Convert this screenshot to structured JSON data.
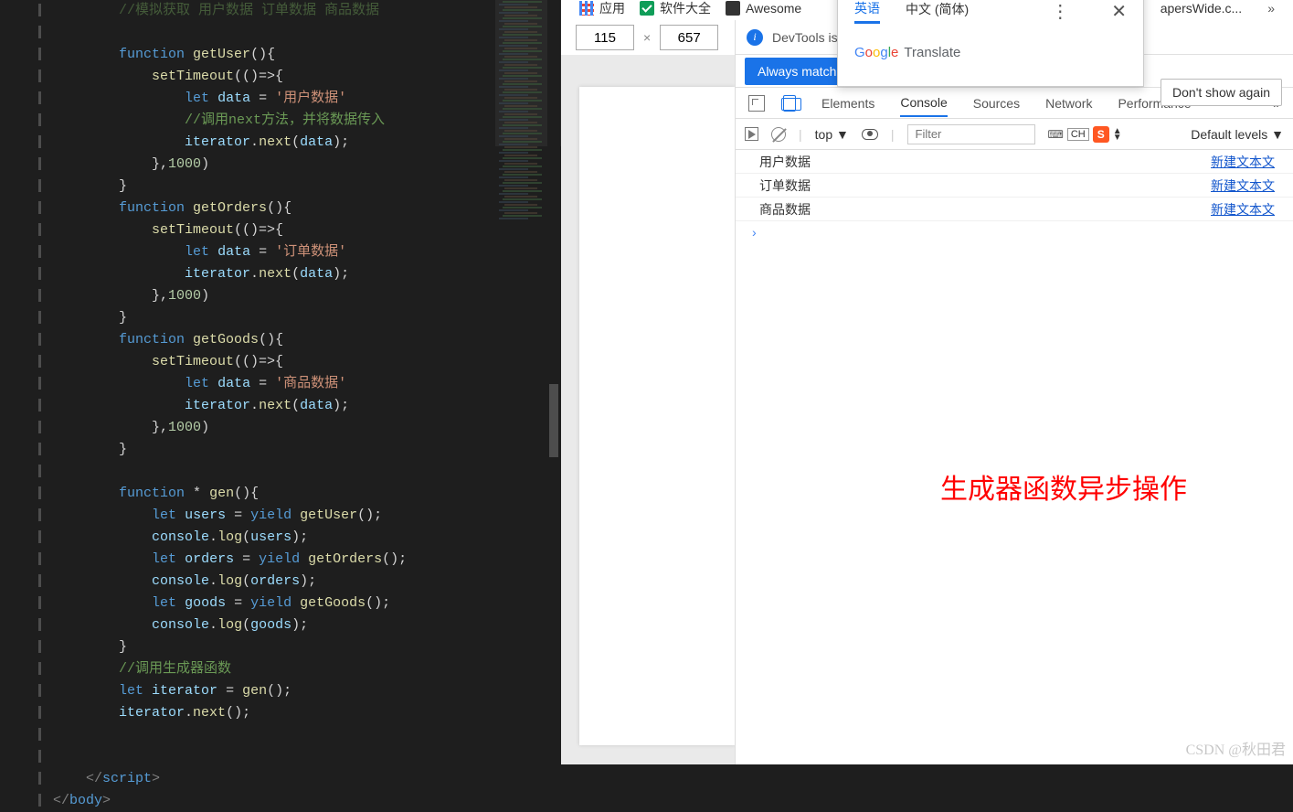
{
  "editor": {
    "topComment": "//模拟获取 用户数据 订单数据 商品数据",
    "lines": [
      {
        "indent": 2,
        "html": "<span class='cmt'>//模拟获取 用户数据 订单数据 商品数据</span>"
      },
      {
        "indent": 2,
        "html": ""
      },
      {
        "indent": 2,
        "html": "<span class='kw'>function</span> <span class='fn'>getUser</span><span class='pn'>(){</span>"
      },
      {
        "indent": 3,
        "html": "<span class='fn'>setTimeout</span><span class='pn'>(()=&gt;{</span>"
      },
      {
        "indent": 4,
        "html": "<span class='kw'>let</span> <span class='var'>data</span> <span class='op'>=</span> <span class='str'>'用户数据'</span>"
      },
      {
        "indent": 4,
        "html": "<span class='cmt'>//调用next方法，并将数据传入</span>"
      },
      {
        "indent": 4,
        "html": "<span class='var'>iterator</span><span class='pn'>.</span><span class='fn'>next</span><span class='pn'>(</span><span class='var'>data</span><span class='pn'>);</span>"
      },
      {
        "indent": 3,
        "html": "<span class='pn'>},</span><span class='num'>1000</span><span class='pn'>)</span>"
      },
      {
        "indent": 2,
        "html": "<span class='pn'>}</span>"
      },
      {
        "indent": 2,
        "html": "<span class='kw'>function</span> <span class='fn'>getOrders</span><span class='pn'>(){</span>"
      },
      {
        "indent": 3,
        "html": "<span class='fn'>setTimeout</span><span class='pn'>(()=&gt;{</span>"
      },
      {
        "indent": 4,
        "html": "<span class='kw'>let</span> <span class='var'>data</span> <span class='op'>=</span> <span class='str'>'订单数据'</span>"
      },
      {
        "indent": 4,
        "html": "<span class='var'>iterator</span><span class='pn'>.</span><span class='fn'>next</span><span class='pn'>(</span><span class='var'>data</span><span class='pn'>);</span>"
      },
      {
        "indent": 3,
        "html": "<span class='pn'>},</span><span class='num'>1000</span><span class='pn'>)</span>"
      },
      {
        "indent": 2,
        "html": "<span class='pn'>}</span>"
      },
      {
        "indent": 2,
        "html": "<span class='kw'>function</span> <span class='fn'>getGoods</span><span class='pn'>(){</span>"
      },
      {
        "indent": 3,
        "html": "<span class='fn'>setTimeout</span><span class='pn'>(()=&gt;{</span>"
      },
      {
        "indent": 4,
        "html": "<span class='kw'>let</span> <span class='var'>data</span> <span class='op'>=</span> <span class='str'>'商品数据'</span>"
      },
      {
        "indent": 4,
        "html": "<span class='var'>iterator</span><span class='pn'>.</span><span class='fn'>next</span><span class='pn'>(</span><span class='var'>data</span><span class='pn'>);</span>"
      },
      {
        "indent": 3,
        "html": "<span class='pn'>},</span><span class='num'>1000</span><span class='pn'>)</span>"
      },
      {
        "indent": 2,
        "html": "<span class='pn'>}</span>"
      },
      {
        "indent": 2,
        "html": ""
      },
      {
        "indent": 2,
        "html": "<span class='kw'>function</span> <span class='op'>*</span> <span class='fn'>gen</span><span class='pn'>(){</span>"
      },
      {
        "indent": 3,
        "html": "<span class='kw'>let</span> <span class='var'>users</span> <span class='op'>=</span> <span class='kw'>yield</span> <span class='fn'>getUser</span><span class='pn'>();</span>"
      },
      {
        "indent": 3,
        "html": "<span class='var'>console</span><span class='pn'>.</span><span class='fn'>log</span><span class='pn'>(</span><span class='var'>users</span><span class='pn'>);</span>"
      },
      {
        "indent": 3,
        "html": "<span class='kw'>let</span> <span class='var'>orders</span> <span class='op'>=</span> <span class='kw'>yield</span> <span class='fn'>getOrders</span><span class='pn'>();</span>"
      },
      {
        "indent": 3,
        "html": "<span class='var'>console</span><span class='pn'>.</span><span class='fn'>log</span><span class='pn'>(</span><span class='var'>orders</span><span class='pn'>);</span>"
      },
      {
        "indent": 3,
        "html": "<span class='kw'>let</span> <span class='var'>goods</span> <span class='op'>=</span> <span class='kw'>yield</span> <span class='fn'>getGoods</span><span class='pn'>();</span>"
      },
      {
        "indent": 3,
        "html": "<span class='var'>console</span><span class='pn'>.</span><span class='fn'>log</span><span class='pn'>(</span><span class='var'>goods</span><span class='pn'>);</span>"
      },
      {
        "indent": 2,
        "html": "<span class='pn'>}</span>"
      },
      {
        "indent": 2,
        "html": "<span class='cmt'>//调用生成器函数</span>"
      },
      {
        "indent": 2,
        "html": "<span class='kw'>let</span> <span class='var'>iterator</span> <span class='op'>=</span> <span class='fn'>gen</span><span class='pn'>();</span>"
      },
      {
        "indent": 2,
        "html": "<span class='var'>iterator</span><span class='pn'>.</span><span class='fn'>next</span><span class='pn'>();</span>"
      },
      {
        "indent": 2,
        "html": ""
      },
      {
        "indent": 2,
        "html": ""
      },
      {
        "indent": 1,
        "html": "<span class='tagn'>&lt;/</span><span class='tag'>script</span><span class='tagn'>&gt;</span>"
      },
      {
        "indent": 0,
        "html": "<span class='tagn'>&lt;/</span><span class='tag'>body</span><span class='tagn'>&gt;</span>"
      }
    ]
  },
  "bookmarks": {
    "apps": "应用",
    "soft": "软件大全",
    "awesome": "Awesome",
    "wall": "apersWide.c..."
  },
  "translate": {
    "tab_en": "英语",
    "tab_zh": "中文 (简体)",
    "brand": "Translate"
  },
  "viewport": {
    "w": "115",
    "x": "×",
    "h": "657"
  },
  "notice": {
    "text": "DevTools is ",
    "always": "Always match ",
    "dont": "Don't show again"
  },
  "tabs": {
    "elements": "Elements",
    "console": "Console",
    "sources": "Sources",
    "network": "Network",
    "performance": "Performance",
    "more": "»"
  },
  "filter": {
    "top": "top ▼",
    "placeholder": "Filter",
    "levels": "Default levels ▼",
    "ime_ch": "CH",
    "ime_s": "S"
  },
  "console": {
    "rows": [
      {
        "msg": "用户数据",
        "src": "新建文本文"
      },
      {
        "msg": "订单数据",
        "src": "新建文本文"
      },
      {
        "msg": "商品数据",
        "src": "新建文本文"
      }
    ],
    "prompt": "›"
  },
  "annotation": "生成器函数异步操作",
  "watermark": "CSDN @秋田君"
}
